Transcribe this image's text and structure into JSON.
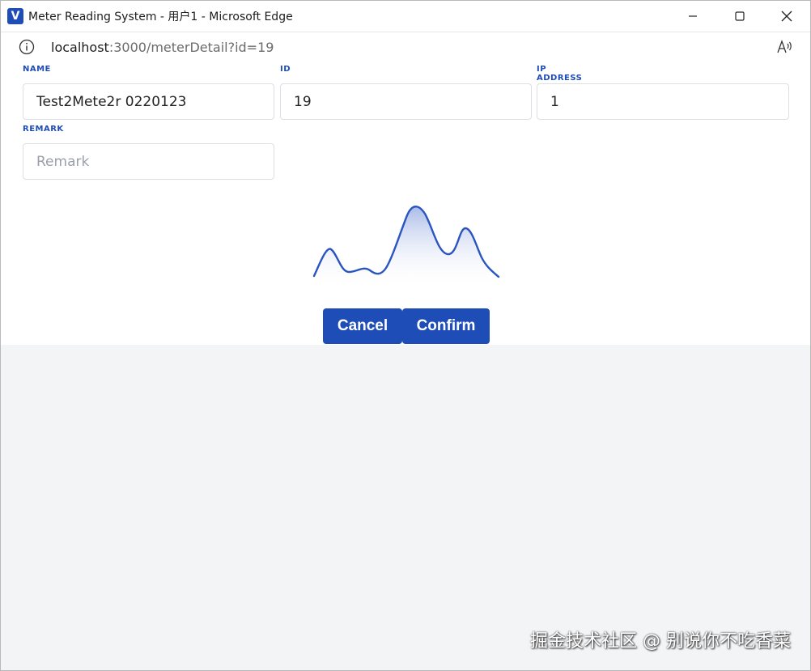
{
  "window": {
    "title": "Meter Reading System - 用户1 - Microsoft Edge",
    "app_icon_letter": "V"
  },
  "address_bar": {
    "host": "localhost",
    "path": ":3000/meterDetail?id=19"
  },
  "form": {
    "name": {
      "label": "NAME",
      "value": "Test2Mete2r 0220123"
    },
    "id": {
      "label": "ID",
      "value": "19"
    },
    "ip_address": {
      "label": "IP ADDRESS",
      "value": "1"
    },
    "remark": {
      "label": "REMARK",
      "value": "",
      "placeholder": "Remark"
    }
  },
  "buttons": {
    "cancel_label": "Cancel",
    "confirm_label": "Confirm"
  },
  "watermark": "掘金技术社区 @ 别说你不吃香菜",
  "colors": {
    "accent": "#1f4db8",
    "label": "#1f4db8",
    "page_background": "#f3f4f6",
    "chart_line": "#2a55c0"
  },
  "icons": {
    "info": "info-icon",
    "read_aloud": "read-aloud-icon",
    "minimize": "minimize-icon",
    "maximize": "maximize-icon",
    "close": "close-icon"
  }
}
